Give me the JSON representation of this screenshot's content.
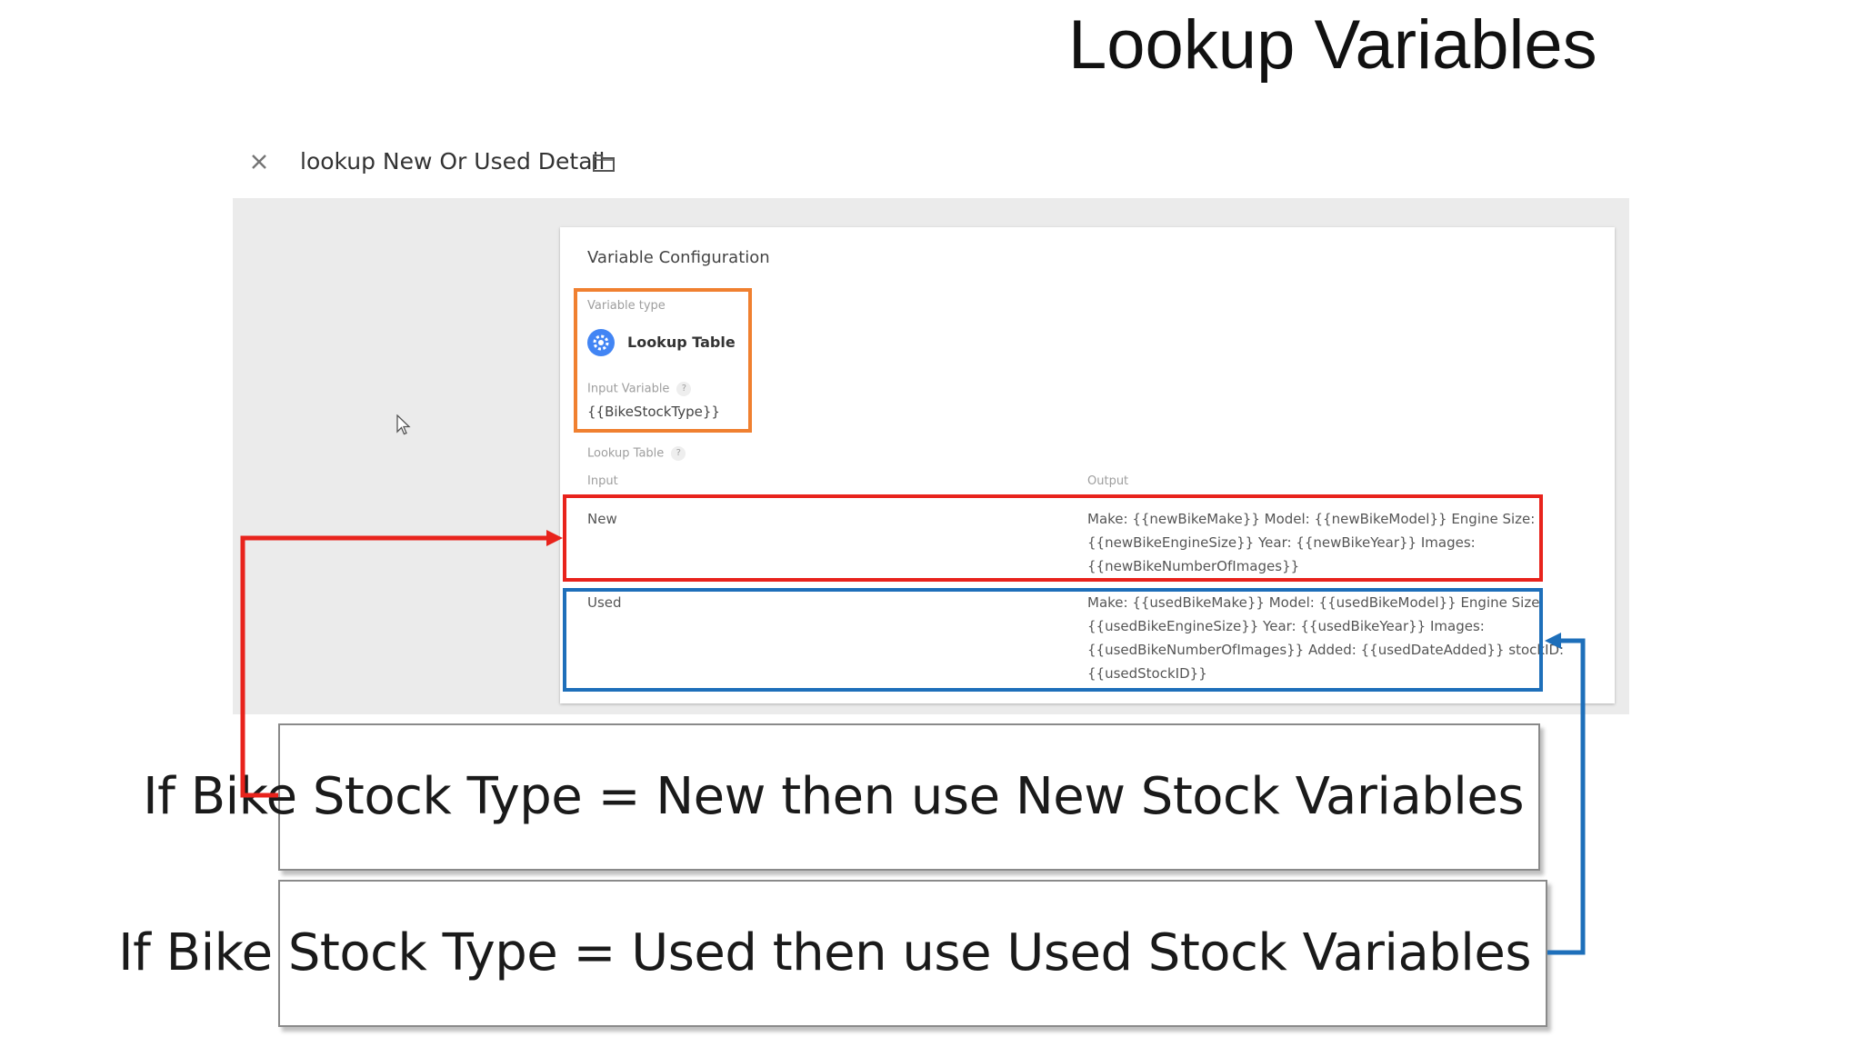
{
  "slide": {
    "title": "Lookup Variables"
  },
  "header": {
    "close_icon": "close-icon",
    "variable_name": "lookup New Or Used Detail",
    "folder_icon": "folder-icon"
  },
  "config": {
    "section_title": "Variable Configuration",
    "variable_type_label": "Variable type",
    "variable_type_icon": "lookup-table-icon",
    "variable_type_name": "Lookup Table",
    "input_variable_label": "Input Variable",
    "input_variable_value": "{{BikeStockType}}",
    "help_glyph": "?",
    "lookup_table_label": "Lookup Table",
    "table": {
      "headers": {
        "input": "Input",
        "output": "Output"
      },
      "rows": [
        {
          "input": "New",
          "output_lines": [
            "Make: {{newBikeMake}} Model: {{newBikeModel}} Engine Size:",
            "{{newBikeEngineSize}} Year: {{newBikeYear}} Images:",
            "{{newBikeNumberOfImages}}"
          ]
        },
        {
          "input": "Used",
          "output_lines": [
            "Make: {{usedBikeMake}} Model: {{usedBikeModel}} Engine Size:",
            "{{usedBikeEngineSize}} Year: {{usedBikeYear}} Images:",
            "{{usedBikeNumberOfImages}} Added: {{usedDateAdded}} stockID:",
            "{{usedStockID}}"
          ]
        }
      ]
    }
  },
  "callouts": {
    "new": "If Bike Stock Type = New then use New Stock Variables",
    "used": "If Bike Stock Type = Used then use Used Stock Variables"
  },
  "colors": {
    "orange_highlight": "#f08030",
    "red_highlight": "#e8231c",
    "blue_highlight": "#1e6fba",
    "type_icon": "#4285f4",
    "panel_gray": "#ebebeb"
  }
}
